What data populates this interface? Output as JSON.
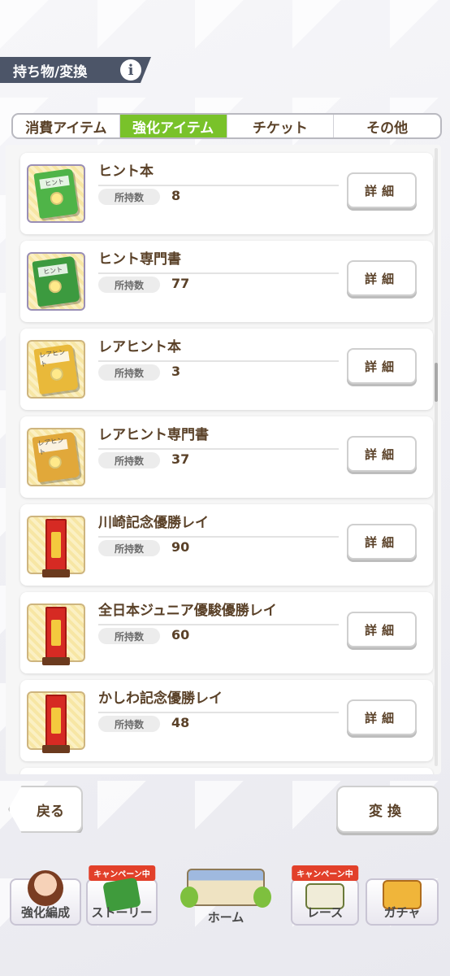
{
  "header": {
    "title": "持ち物/変換",
    "info_icon": "i"
  },
  "tabs": [
    {
      "label": "消費アイテム",
      "active": false
    },
    {
      "label": "強化アイテム",
      "active": true
    },
    {
      "label": "チケット",
      "active": false
    },
    {
      "label": "その他",
      "active": false
    }
  ],
  "item_list": {
    "count_label": "所持数",
    "detail_label": "詳細",
    "items": [
      {
        "name": "ヒント本",
        "count": "8",
        "icon": "hint-book-icon"
      },
      {
        "name": "ヒント専門書",
        "count": "77",
        "icon": "hint-specialist-book-icon"
      },
      {
        "name": "レアヒント本",
        "count": "3",
        "icon": "rare-hint-book-icon"
      },
      {
        "name": "レアヒント専門書",
        "count": "37",
        "icon": "rare-hint-specialist-book-icon"
      },
      {
        "name": "川崎記念優勝レイ",
        "count": "90",
        "icon": "victory-sash-icon"
      },
      {
        "name": "全日本ジュニア優駿優勝レイ",
        "count": "60",
        "icon": "victory-sash-icon"
      },
      {
        "name": "かしわ記念優勝レイ",
        "count": "48",
        "icon": "victory-sash-icon"
      }
    ]
  },
  "footer": {
    "back_label": "戻る",
    "exchange_label": "変換"
  },
  "bottom_nav": [
    {
      "label": "強化編成",
      "badge": ""
    },
    {
      "label": "ストーリー",
      "badge": "キャンペーン中"
    },
    {
      "label": "ホーム",
      "badge": ""
    },
    {
      "label": "レース",
      "badge": "キャンペーン中"
    },
    {
      "label": "ガチャ",
      "badge": ""
    }
  ],
  "colors": {
    "active_tab": "#79c22a",
    "title_bar": "#4c5568",
    "text_brown": "#5a4128",
    "badge_red": "#e2402a"
  }
}
